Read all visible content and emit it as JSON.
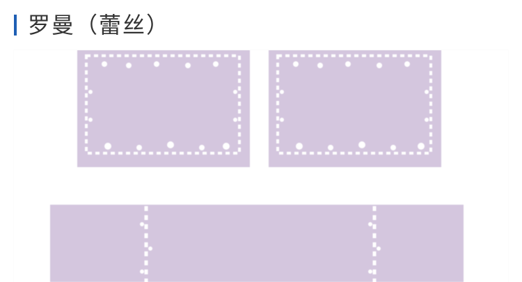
{
  "section": {
    "title": "罗曼（蕾丝）"
  },
  "colors": {
    "accent_bar": "#1f5fb4",
    "title_text": "#333333",
    "mat_fill": "#d4c6de",
    "lace": "#ffffff"
  },
  "product_image": {
    "subject": "lavender-bath-mat-set-with-white-lace-trim",
    "pieces": [
      "small-rug-left",
      "small-rug-right",
      "long-runner"
    ]
  }
}
